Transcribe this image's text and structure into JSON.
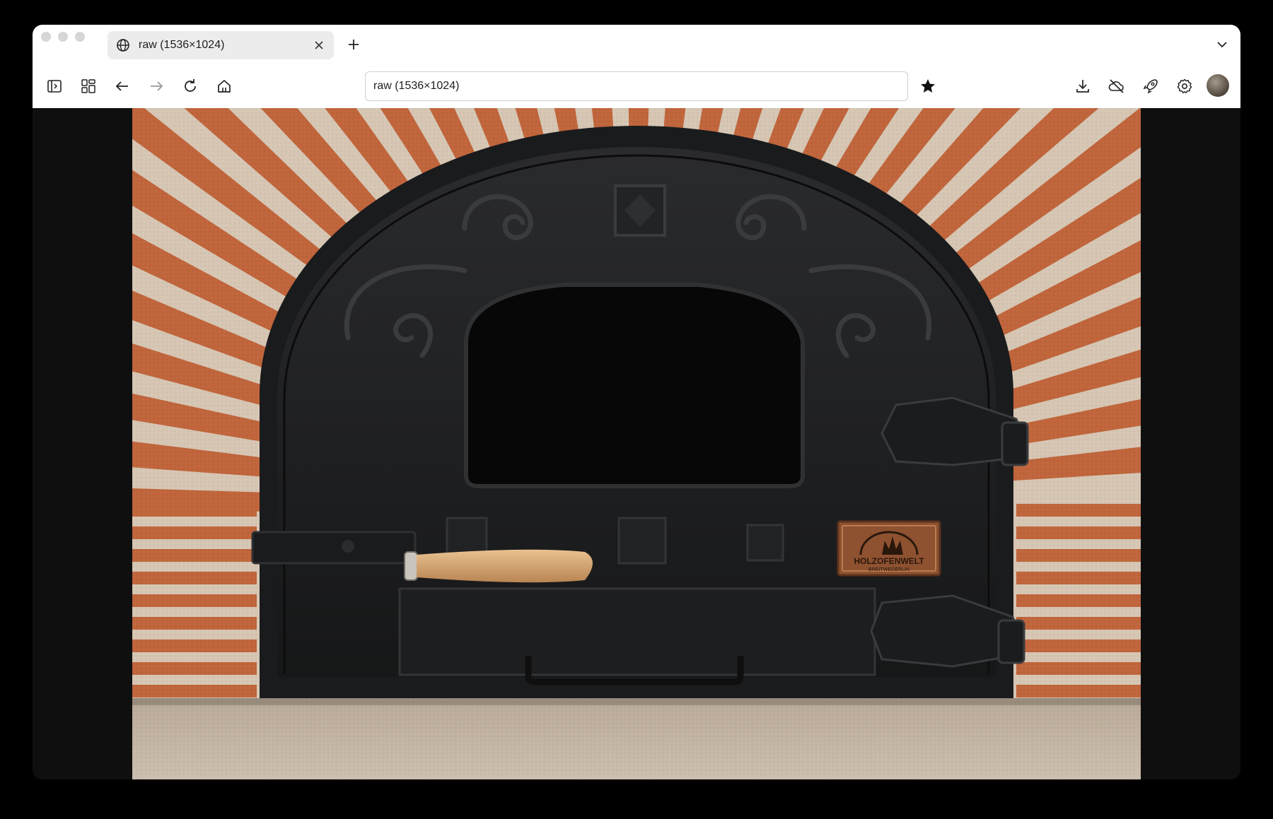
{
  "tab": {
    "title": "raw (1536×1024)"
  },
  "address_bar": {
    "value": "raw (1536×1024)"
  },
  "image": {
    "alt": "Cast iron pizza oven door with arched brick surround"
  },
  "badge": {
    "brand": "HOLZOFENWELT",
    "sub": "BREITWEGERLIN"
  },
  "colors": {
    "brick": "#c0653c",
    "mortar": "#d9c8b4",
    "iron": "#1c1d1f",
    "handle_wood": "#d9a978",
    "badge": "#9a5a33"
  },
  "icons": [
    "globe-icon",
    "close-icon",
    "plus-icon",
    "chevron-down-icon",
    "sidebar-toggle-icon",
    "tab-groups-icon",
    "back-icon",
    "forward-icon",
    "reload-icon",
    "home-icon",
    "bookmark-star-icon",
    "download-icon",
    "cloud-off-icon",
    "rocket-icon",
    "settings-gear-icon"
  ]
}
